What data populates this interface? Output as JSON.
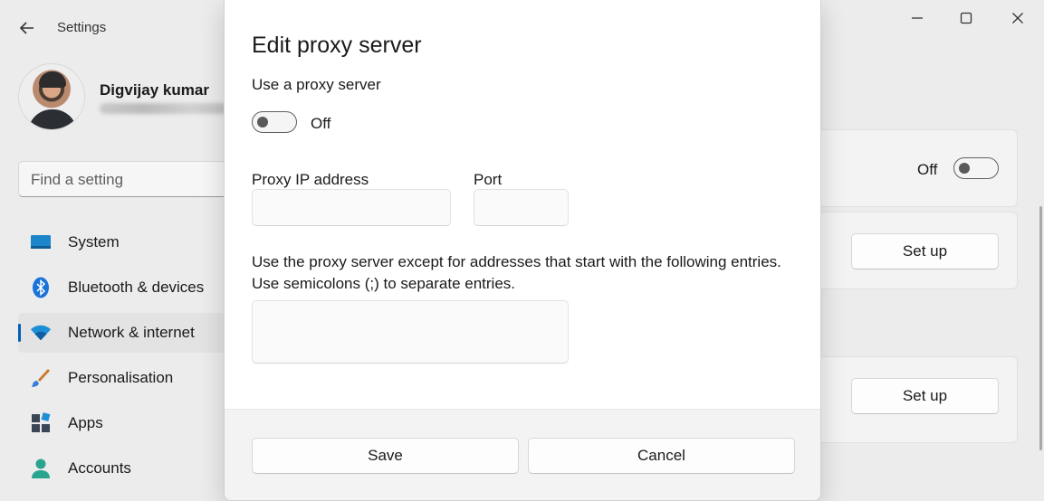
{
  "window": {
    "title": "Settings",
    "controls": {
      "minimize_icon": "minimize-icon",
      "maximize_icon": "maximize-icon",
      "close_icon": "close-icon"
    }
  },
  "profile": {
    "name": "Digvijay kumar"
  },
  "search": {
    "placeholder": "Find a setting"
  },
  "sidebar": {
    "items": [
      {
        "label": "System",
        "icon": "monitor-icon",
        "active": false
      },
      {
        "label": "Bluetooth & devices",
        "icon": "bluetooth-icon",
        "active": false
      },
      {
        "label": "Network & internet",
        "icon": "wifi-icon",
        "active": true
      },
      {
        "label": "Personalisation",
        "icon": "brush-icon",
        "active": false
      },
      {
        "label": "Apps",
        "icon": "apps-icon",
        "active": false
      },
      {
        "label": "Accounts",
        "icon": "person-icon",
        "active": false
      }
    ]
  },
  "background": {
    "toggle_state_label": "Off",
    "setup_button_1": "Set up",
    "setup_button_2": "Set up"
  },
  "dialog": {
    "title": "Edit proxy server",
    "use_proxy_label": "Use a proxy server",
    "use_proxy_state": "Off",
    "ip_label": "Proxy IP address",
    "ip_value": "",
    "port_label": "Port",
    "port_value": "",
    "except_label_line1": "Use the proxy server except for addresses that start with the following entries.",
    "except_label_line2": "Use semicolons (;) to separate entries.",
    "except_value": "",
    "save_label": "Save",
    "cancel_label": "Cancel"
  },
  "colors": {
    "accent": "#005fb8",
    "background": "#ececec",
    "dialog": "#ffffff",
    "footer": "#f3f3f3"
  }
}
